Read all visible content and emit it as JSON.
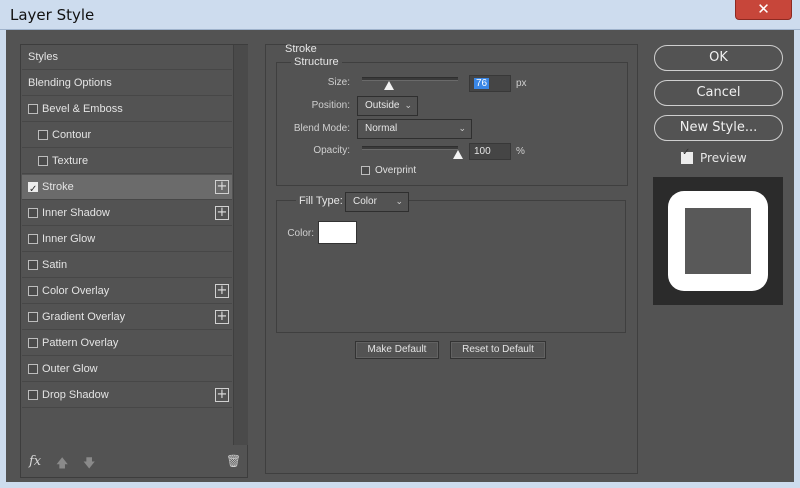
{
  "window": {
    "title": "Layer Style",
    "close_glyph": "✕"
  },
  "styles_list": {
    "items": [
      {
        "label": "Styles",
        "checkbox": false,
        "checked": false,
        "indent": false,
        "plus": false,
        "selected": false
      },
      {
        "label": "Blending Options",
        "checkbox": false,
        "checked": false,
        "indent": false,
        "plus": false,
        "selected": false
      },
      {
        "label": "Bevel & Emboss",
        "checkbox": true,
        "checked": false,
        "indent": false,
        "plus": false,
        "selected": false
      },
      {
        "label": "Contour",
        "checkbox": true,
        "checked": false,
        "indent": true,
        "plus": false,
        "selected": false
      },
      {
        "label": "Texture",
        "checkbox": true,
        "checked": false,
        "indent": true,
        "plus": false,
        "selected": false
      },
      {
        "label": "Stroke",
        "checkbox": true,
        "checked": true,
        "indent": false,
        "plus": true,
        "selected": true
      },
      {
        "label": "Inner Shadow",
        "checkbox": true,
        "checked": false,
        "indent": false,
        "plus": true,
        "selected": false
      },
      {
        "label": "Inner Glow",
        "checkbox": true,
        "checked": false,
        "indent": false,
        "plus": false,
        "selected": false
      },
      {
        "label": "Satin",
        "checkbox": true,
        "checked": false,
        "indent": false,
        "plus": false,
        "selected": false
      },
      {
        "label": "Color Overlay",
        "checkbox": true,
        "checked": false,
        "indent": false,
        "plus": true,
        "selected": false
      },
      {
        "label": "Gradient Overlay",
        "checkbox": true,
        "checked": false,
        "indent": false,
        "plus": true,
        "selected": false
      },
      {
        "label": "Pattern Overlay",
        "checkbox": true,
        "checked": false,
        "indent": false,
        "plus": false,
        "selected": false
      },
      {
        "label": "Outer Glow",
        "checkbox": true,
        "checked": false,
        "indent": false,
        "plus": false,
        "selected": false
      },
      {
        "label": "Drop Shadow",
        "checkbox": true,
        "checked": false,
        "indent": false,
        "plus": true,
        "selected": false
      }
    ],
    "plus_glyph": "+",
    "footer": {
      "fx": "fx",
      "up_arrow": "🡅",
      "down_arrow": "🡇",
      "trash": "🗑"
    }
  },
  "stroke": {
    "panel_title": "Stroke",
    "structure": {
      "title": "Structure",
      "size_label": "Size:",
      "size_value": "76",
      "size_unit": "px",
      "size_slider_fraction": 0.28,
      "position_label": "Position:",
      "position_value": "Outside",
      "blend_mode_label": "Blend Mode:",
      "blend_mode_value": "Normal",
      "opacity_label": "Opacity:",
      "opacity_value": "100",
      "opacity_unit": "%",
      "opacity_slider_fraction": 1.0,
      "overprint_label": "Overprint",
      "overprint_checked": false
    },
    "fill": {
      "fill_type_label": "Fill Type:",
      "fill_type_value": "Color",
      "color_label": "Color:",
      "color_value": "#ffffff"
    },
    "make_default": "Make Default",
    "reset_default": "Reset to Default"
  },
  "actions": {
    "ok": "OK",
    "cancel": "Cancel",
    "new_style": "New Style...",
    "preview_label": "Preview",
    "preview_checked": true
  },
  "chevron": "⌄"
}
